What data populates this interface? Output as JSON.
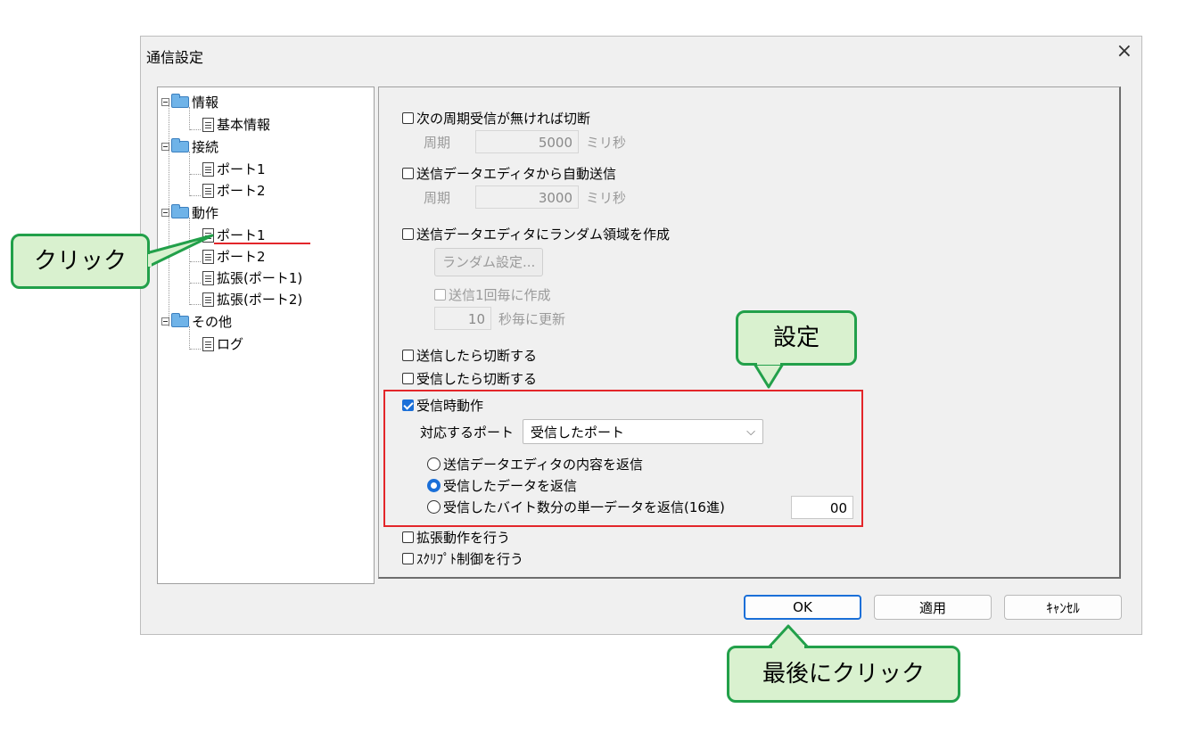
{
  "dialog": {
    "title": "通信設定",
    "close": "×"
  },
  "tree": {
    "nodes": [
      {
        "label": "情報"
      },
      {
        "label": "基本情報"
      },
      {
        "label": "接続"
      },
      {
        "label": "ポート1"
      },
      {
        "label": "ポート2"
      },
      {
        "label": "動作"
      },
      {
        "label": "ポート1"
      },
      {
        "label": "ポート2"
      },
      {
        "label": "拡張(ポート1)"
      },
      {
        "label": "拡張(ポート2)"
      },
      {
        "label": "その他"
      },
      {
        "label": "ログ"
      }
    ]
  },
  "panel": {
    "opt_periodic": {
      "label": "次の周期受信が無ければ切断",
      "checked": false,
      "period_label": "周期",
      "value": "5000",
      "unit": "ミリ秒"
    },
    "opt_auto_send": {
      "label": "送信データエディタから自動送信",
      "checked": false,
      "period_label": "周期",
      "value": "3000",
      "unit": "ミリ秒"
    },
    "opt_random": {
      "label": "送信データエディタにランダム領域を作成",
      "checked": false,
      "button": "ランダム設定...",
      "sub_check": "送信1回毎に作成",
      "interval_value": "10",
      "interval_unit": "秒毎に更新"
    },
    "opt_disconnect_send": {
      "label": "送信したら切断する",
      "checked": false
    },
    "opt_disconnect_recv": {
      "label": "受信したら切断する",
      "checked": false
    },
    "opt_recv_action": {
      "label": "受信時動作",
      "checked": true,
      "port_label": "対応するポート",
      "port_value": "受信したポート",
      "radios": [
        {
          "label": "送信データエディタの内容を返信",
          "selected": false
        },
        {
          "label": "受信したデータを返信",
          "selected": true
        },
        {
          "label": "受信したバイト数分の単一データを返信(16進)",
          "selected": false
        }
      ],
      "hex_value": "00"
    },
    "opt_extended": {
      "label": "拡張動作を行う",
      "checked": false
    },
    "opt_script": {
      "label": "ｽｸﾘﾌﾟﾄ制御を行う",
      "checked": false
    }
  },
  "buttons": {
    "ok": "OK",
    "apply": "適用",
    "cancel": "ｷｬﾝｾﾙ"
  },
  "annotations": {
    "click": "クリック",
    "setting": "設定",
    "final_click": "最後にクリック"
  },
  "colors": {
    "accent": "#1a6fd8",
    "highlight": "#e3262a",
    "callout_border": "#22a04a",
    "callout_fill": "#d9f1cf"
  }
}
